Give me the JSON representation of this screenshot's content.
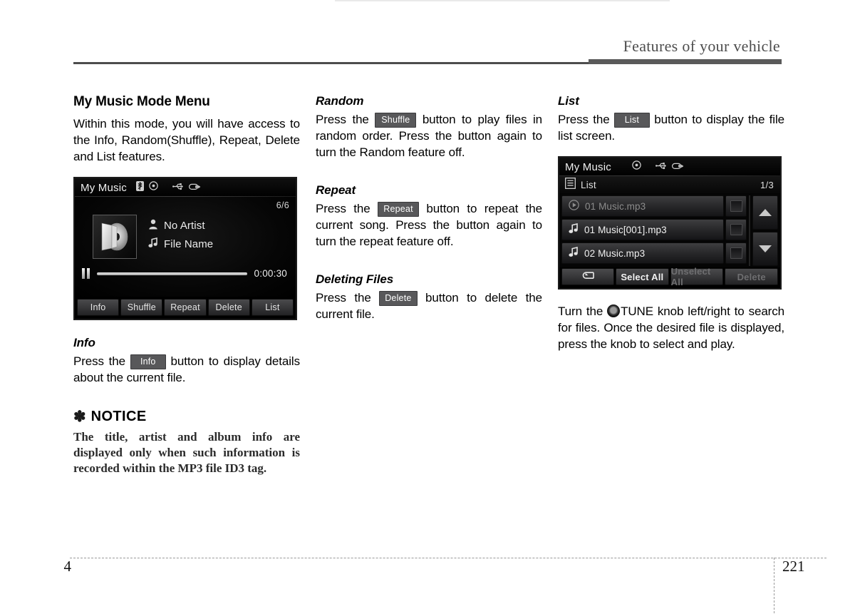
{
  "header": {
    "title": "Features of your vehicle"
  },
  "footer": {
    "chapter": "4",
    "page": "221"
  },
  "column1": {
    "heading": "My Music Mode Menu",
    "intro": "Within this mode, you will have access to the Info, Random(Shuffle), Repeat, Delete and List features.",
    "player_screen": {
      "title": "My Music",
      "icons": [
        "bluetooth-icon",
        "disc-icon",
        "usb-icon",
        "ipod-icon"
      ],
      "track_counter": "6/6",
      "artist": "No Artist",
      "file_name": "File Name",
      "time": "0:00:30",
      "playback_state": "paused",
      "buttons": [
        "Info",
        "Shuffle",
        "Repeat",
        "Delete",
        "List"
      ]
    },
    "info": {
      "heading": "Info",
      "text_before": "Press the",
      "keycap": "Info",
      "text_after": "button to display details about the current file."
    },
    "notice": {
      "symbol": "✽",
      "title": "NOTICE",
      "body": "The title, artist and album info are displayed only when such information is recorded within the MP3 file ID3 tag."
    }
  },
  "column2": {
    "random": {
      "heading": "Random",
      "text_before": "Press the",
      "keycap": "Shuffle",
      "text_after": "button to play files in random order. Press the button again to turn the Random feature off."
    },
    "repeat": {
      "heading": "Repeat",
      "text_before": "Press the",
      "keycap": "Repeat",
      "text_after": "button to repeat the current song. Press the button again to turn the repeat feature off."
    },
    "deleting": {
      "heading": "Deleting Files",
      "text_before": "Press the",
      "keycap": "Delete",
      "text_after": "button to delete the current file."
    }
  },
  "column3": {
    "list": {
      "heading": "List",
      "text_before": "Press the",
      "keycap": "List",
      "text_after": "button to display the file list screen."
    },
    "list_screen": {
      "title": "My Music",
      "icons": [
        "disc-icon",
        "usb-icon",
        "ipod-icon"
      ],
      "subbar_label": "List",
      "page_indicator": "1/3",
      "rows": [
        {
          "name": "01 Music.mp3",
          "icon": "play-circle-icon",
          "state": "playing"
        },
        {
          "name": "01 Music[001].mp3",
          "icon": "music-note-icon",
          "state": "normal"
        },
        {
          "name": "02 Music.mp3",
          "icon": "music-note-icon",
          "state": "normal"
        }
      ],
      "buttons": [
        {
          "label": "",
          "icon": "back-arrow-icon",
          "state": "enabled"
        },
        {
          "label": "Select All",
          "state": "enabled"
        },
        {
          "label": "Unselect All",
          "state": "disabled"
        },
        {
          "label": "Delete",
          "state": "disabled"
        }
      ]
    },
    "tune_text_before": "Turn the",
    "tune_knob_label": "TUNE",
    "tune_text_after": "knob left/right to search for files. Once the desired file is displayed, press the knob to select and play."
  }
}
